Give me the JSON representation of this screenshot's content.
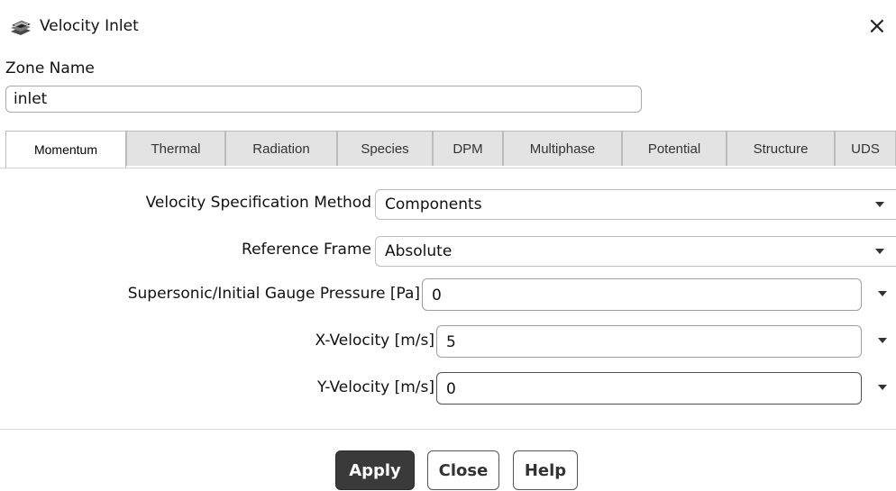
{
  "window": {
    "title": "Velocity Inlet",
    "close_glyph": "×",
    "app_icon": "fluent-layers-icon"
  },
  "zone": {
    "label": "Zone Name",
    "value": "inlet"
  },
  "tabs": [
    {
      "label": "Momentum",
      "active": true
    },
    {
      "label": "Thermal",
      "active": false
    },
    {
      "label": "Radiation",
      "active": false
    },
    {
      "label": "Species",
      "active": false
    },
    {
      "label": "DPM",
      "active": false
    },
    {
      "label": "Multiphase",
      "active": false
    },
    {
      "label": "Potential",
      "active": false
    },
    {
      "label": "Structure",
      "active": false
    },
    {
      "label": "UDS",
      "active": false
    }
  ],
  "momentum": {
    "velocity_method": {
      "label": "Velocity Specification Method",
      "value": "Components"
    },
    "reference_frame": {
      "label": "Reference Frame",
      "value": "Absolute"
    },
    "pressure": {
      "label": "Supersonic/Initial Gauge Pressure [Pa]",
      "value": "0"
    },
    "x_velocity": {
      "label": "X-Velocity [m/s]",
      "value": "5"
    },
    "y_velocity": {
      "label": "Y-Velocity [m/s]",
      "value": "0"
    }
  },
  "buttons": {
    "apply": "Apply",
    "close": "Close",
    "help": "Help"
  },
  "colors": {
    "primary_button": "#3a3a3a",
    "tab_inactive": "#e3e3e3",
    "border": "#bdbdbd"
  }
}
